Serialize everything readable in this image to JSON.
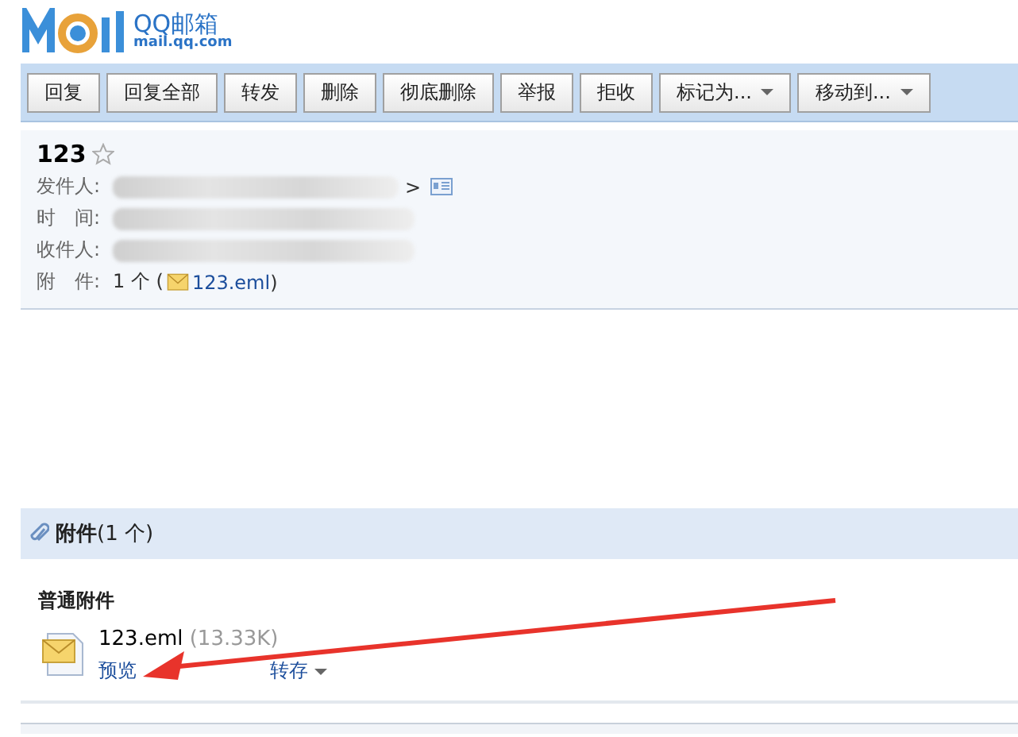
{
  "logo": {
    "brand": "QQ邮箱",
    "domain": "mail.qq.com"
  },
  "toolbar": [
    {
      "label": "回复",
      "kind": "plain"
    },
    {
      "label": "回复全部",
      "kind": "plain"
    },
    {
      "label": "转发",
      "kind": "plain"
    },
    {
      "label": "删除",
      "kind": "plain"
    },
    {
      "label": "彻底删除",
      "kind": "plain"
    },
    {
      "label": "举报",
      "kind": "plain"
    },
    {
      "label": "拒收",
      "kind": "plain"
    },
    {
      "label": "标记为...",
      "kind": "dropdown"
    },
    {
      "label": "移动到...",
      "kind": "dropdown"
    }
  ],
  "mail": {
    "subject": "123",
    "starred": false,
    "fields": [
      {
        "label": "发件人:",
        "kind": "sender",
        "tail": ">"
      },
      {
        "label": "时　间:",
        "kind": "blurred"
      },
      {
        "label": "收件人:",
        "kind": "blurred"
      },
      {
        "label": "附　件:",
        "kind": "attachment",
        "count": "1 个 (",
        "file": "123.eml",
        "close": ")"
      }
    ]
  },
  "attachments": {
    "title": "附件",
    "count": "(1 个)",
    "group": "普通附件",
    "items": [
      {
        "name": "123.eml",
        "size": "(13.33K)",
        "actions": [
          {
            "label": "预览",
            "kind": "link"
          },
          {
            "label": "转存",
            "kind": "dropdown"
          }
        ]
      }
    ]
  }
}
